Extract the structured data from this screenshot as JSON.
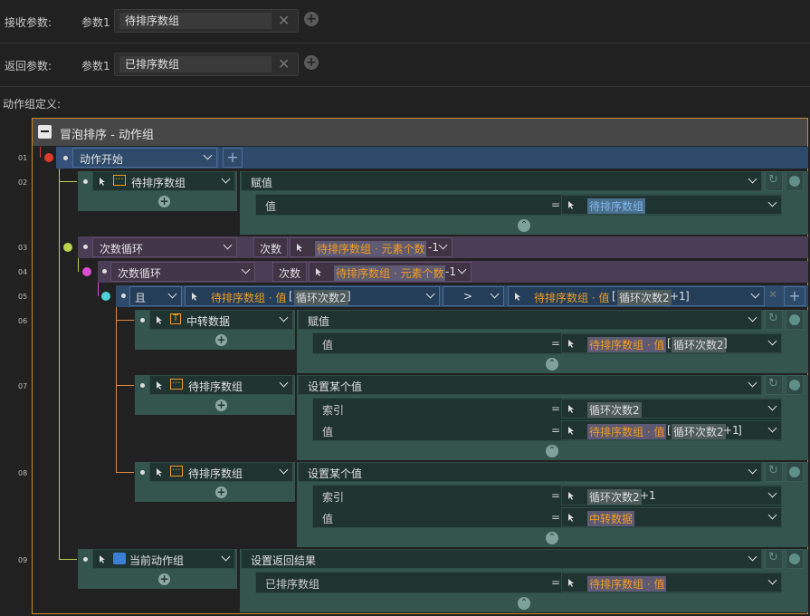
{
  "receive": {
    "label": "接收参数:",
    "param": "参数1",
    "value": "待排序数组"
  },
  "return": {
    "label": "返回参数:",
    "param": "参数1",
    "value": "已排序数组"
  },
  "def_label": "动作组定义:",
  "group_title": "冒泡排序 - 动作组",
  "lines": [
    "01",
    "02",
    "03",
    "04",
    "05",
    "06",
    "07",
    "08",
    "09"
  ],
  "row1": {
    "action": "动作开始"
  },
  "row2": {
    "target": "待排序数组",
    "action": "赋值",
    "field": "值",
    "eq": "=",
    "value": "待排序数组"
  },
  "row3": {
    "loop": "次数循环",
    "count_label": "次数",
    "expr": "待排序数组 · 元素个数",
    "suffix": "-1"
  },
  "row4": {
    "loop": "次数循环",
    "count_label": "次数",
    "expr": "待排序数组 · 元素个数",
    "suffix": "-1"
  },
  "row5": {
    "cond": "且",
    "left_a": "待排序数组 · 值",
    "left_idx": "循环次数2",
    "op": ">",
    "right_a": "待排序数组 · 值",
    "right_idx": "循环次数2",
    "right_suffix": "+1"
  },
  "row6": {
    "target": "中转数据",
    "action": "赋值",
    "field": "值",
    "value_a": "待排序数组 · 值",
    "value_idx": "循环次数2"
  },
  "row7": {
    "target": "待排序数组",
    "action": "设置某个值",
    "f1": "索引",
    "v1": "循环次数2",
    "f2": "值",
    "v2a": "待排序数组 · 值",
    "v2idx": "循环次数2",
    "v2suf": "+1"
  },
  "row8": {
    "target": "待排序数组",
    "action": "设置某个值",
    "f1": "索引",
    "v1": "循环次数2",
    "v1suf": "+1",
    "f2": "值",
    "v2": "中转数据"
  },
  "row9": {
    "target": "当前动作组",
    "action": "设置返回结果",
    "field": "已排序数组",
    "value": "待排序数组 · 值"
  },
  "colors": {
    "accent": "#f29c1f",
    "bg": "#212121",
    "box": "#34544e"
  },
  "icons": [
    "cursor-icon",
    "array-icon",
    "text-icon",
    "group-icon",
    "refresh-icon",
    "clock-icon",
    "collapse-icon",
    "add-icon",
    "delete-icon"
  ]
}
